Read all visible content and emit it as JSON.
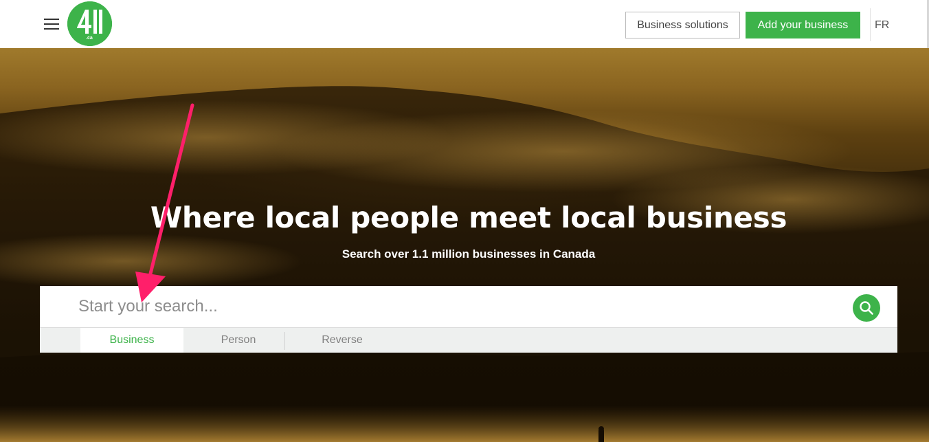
{
  "header": {
    "logo_text": "411.ca",
    "business_solutions_label": "Business solutions",
    "add_business_label": "Add your business",
    "language_label": "FR"
  },
  "hero": {
    "title": "Where local people meet local business",
    "subtitle": "Search over 1.1 million businesses in Canada"
  },
  "search": {
    "placeholder": "Start your search...",
    "value": "",
    "tabs": [
      {
        "label": "Business",
        "active": true
      },
      {
        "label": "Person",
        "active": false
      },
      {
        "label": "Reverse",
        "active": false
      }
    ]
  },
  "colors": {
    "brand_green": "#3db34a",
    "annotation_arrow": "#ff1f6a"
  },
  "icons": {
    "menu": "hamburger-menu-icon",
    "search": "search-icon"
  }
}
